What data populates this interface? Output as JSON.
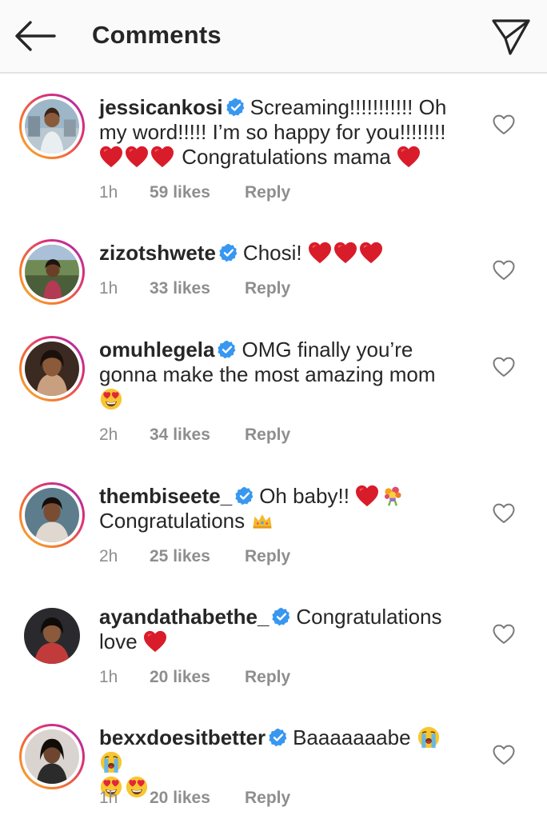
{
  "header": {
    "title": "Comments"
  },
  "comments": [
    {
      "username": "jessicankosi",
      "text1": "Screaming!!!!!!!!!!! Oh my word!!!!! I’m so happy for you!!!!!!!!",
      "text2": "Congratulations mama",
      "time": "1h",
      "likes": "59 likes",
      "reply": "Reply"
    },
    {
      "username": "zizotshwete",
      "text1": "Chosi!",
      "time": "1h",
      "likes": "33 likes",
      "reply": "Reply"
    },
    {
      "username": "omuhlegela",
      "text1": "OMG finally you’re gonna make the most amazing mom",
      "time": "2h",
      "likes": "34 likes",
      "reply": "Reply"
    },
    {
      "username": "thembiseete_",
      "text1": "Oh baby!!",
      "text2": "Congratulations",
      "time": "2h",
      "likes": "25 likes",
      "reply": "Reply"
    },
    {
      "username": "ayandathabethe_",
      "text1": "Congratulations love",
      "time": "1h",
      "likes": "20 likes",
      "reply": "Reply"
    },
    {
      "username": "bexxdoesitbetter",
      "text1": "Baaaaaaabe",
      "time": "1h",
      "likes": "20 likes",
      "reply": "Reply"
    }
  ]
}
